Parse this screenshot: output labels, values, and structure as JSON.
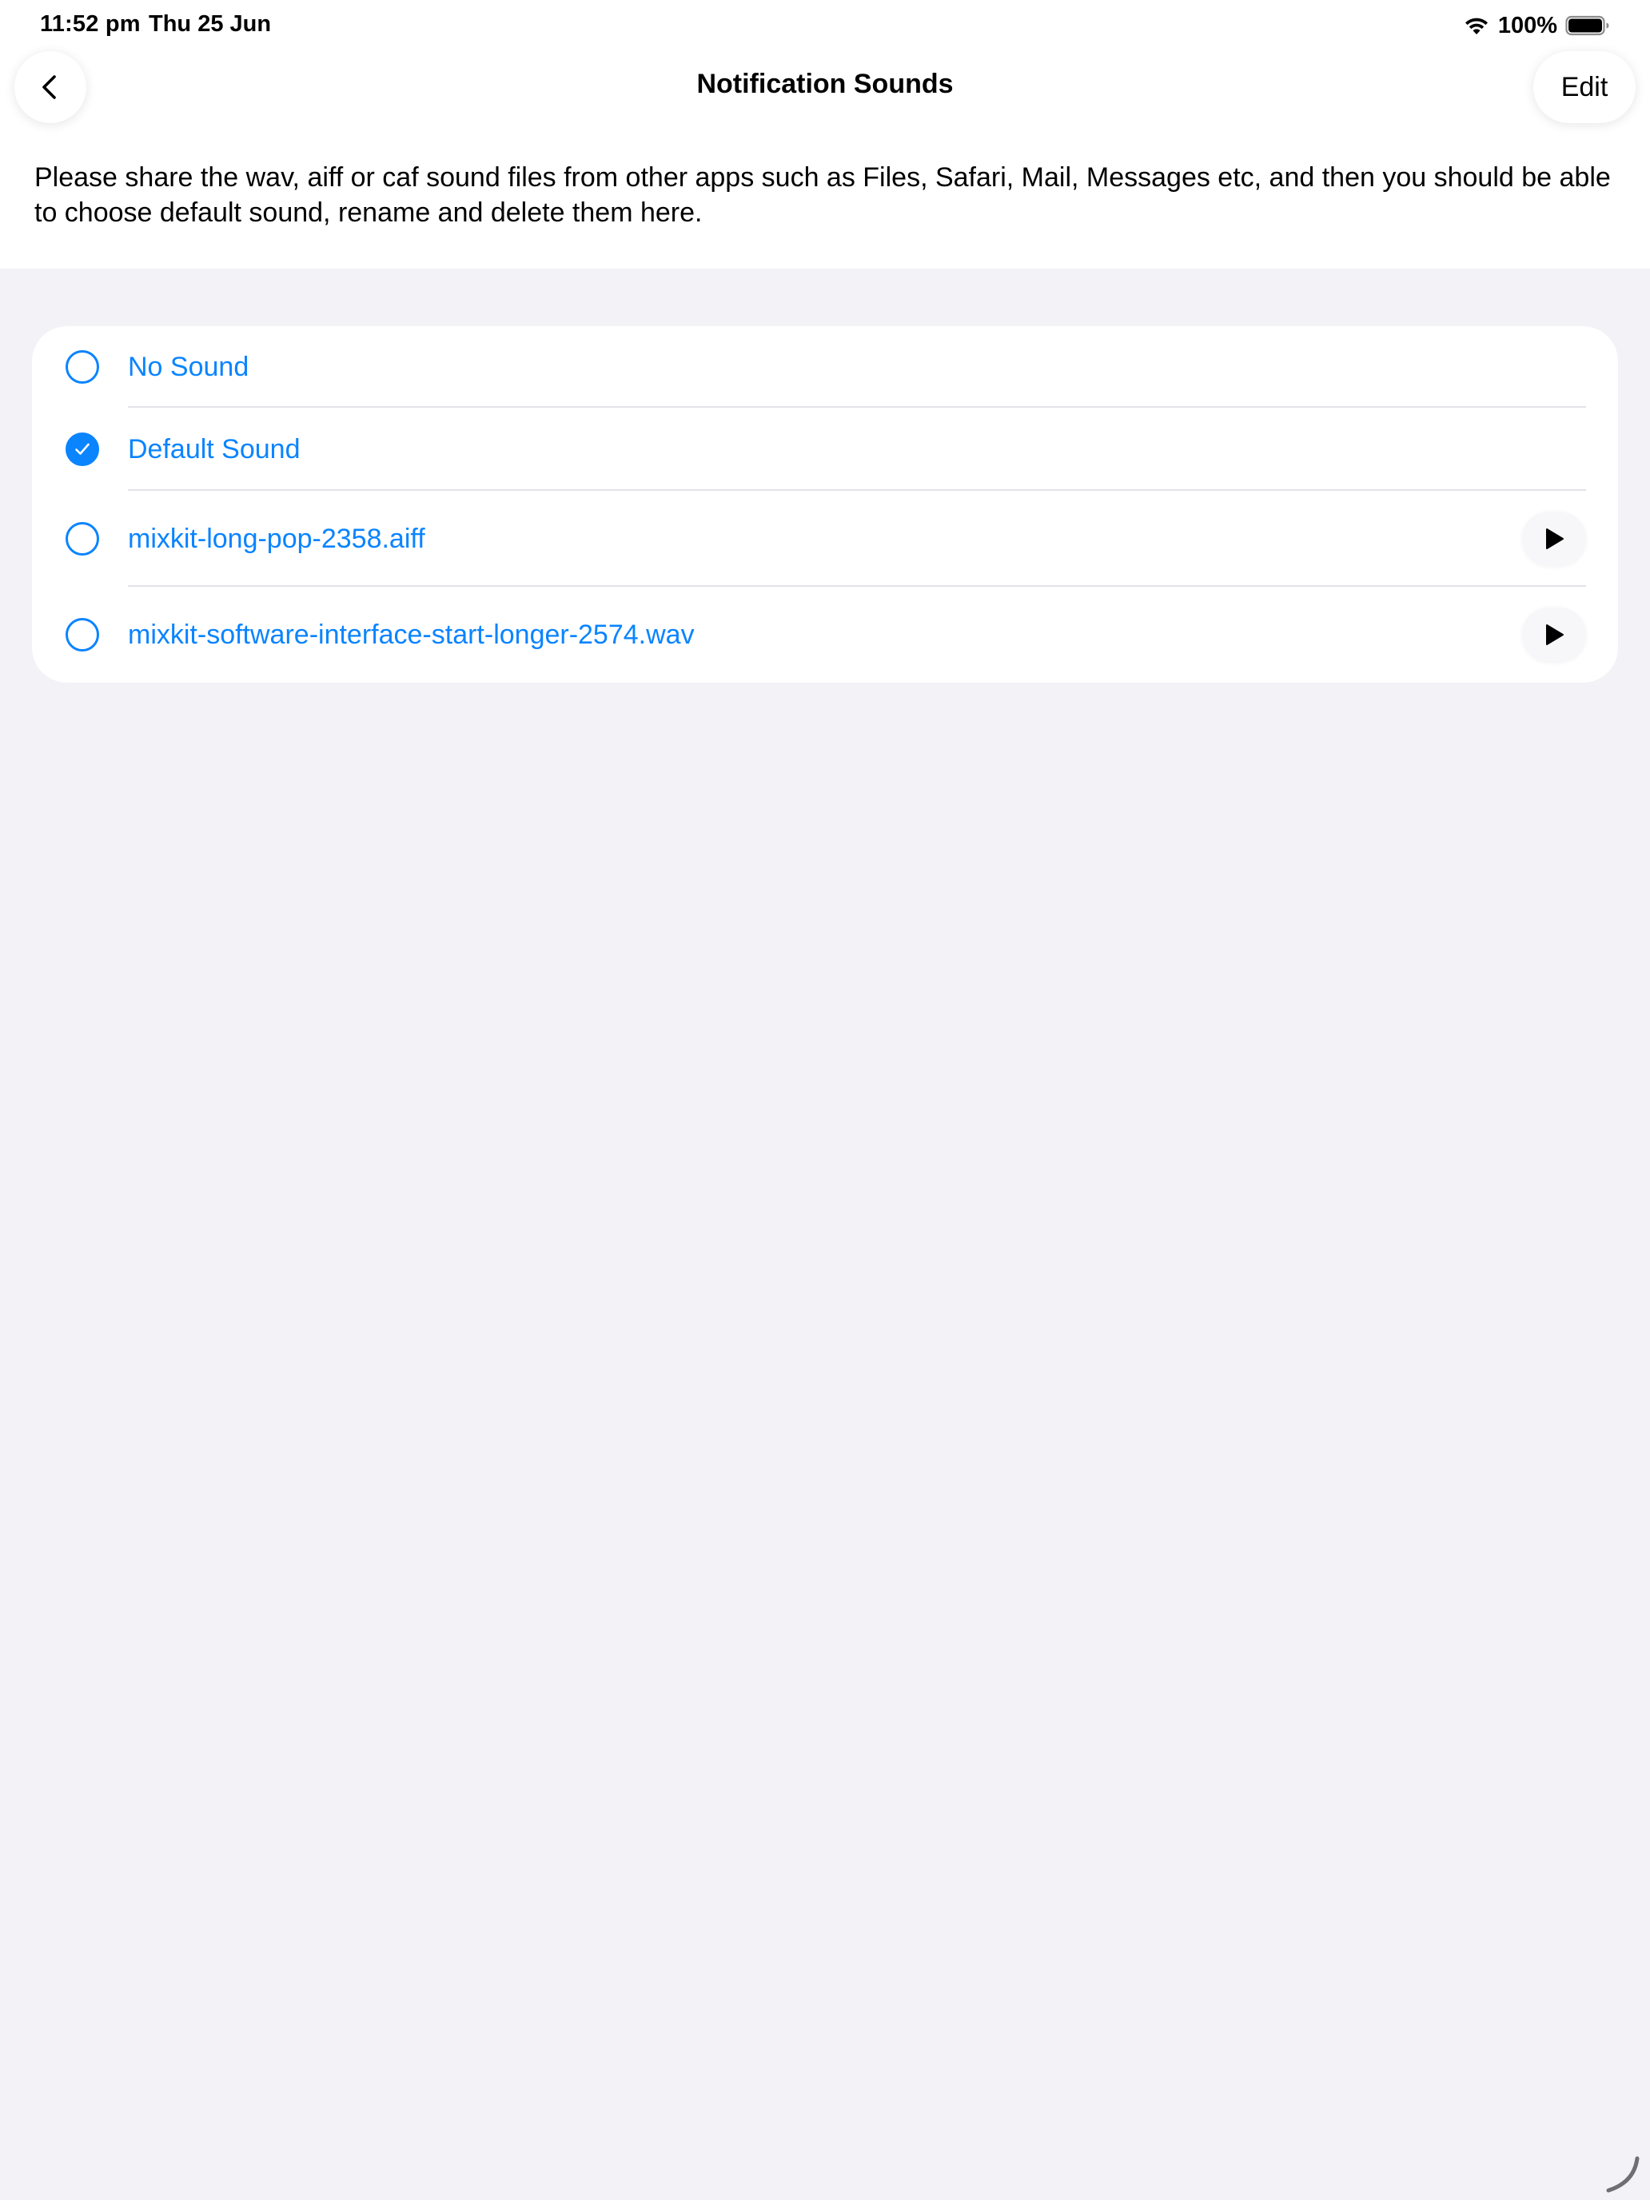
{
  "status_bar": {
    "time": "11:52 pm",
    "date": "Thu 25 Jun",
    "battery_percent": "100%",
    "icons": [
      "wifi-icon",
      "battery-icon"
    ]
  },
  "nav": {
    "title": "Notification Sounds",
    "back_icon": "chevron-left-icon",
    "edit_label": "Edit"
  },
  "description": "Please share the wav, aiff or caf sound files from other apps such as Files, Safari, Mail, Messages etc, and then you should be able to choose default sound, rename and delete them here.",
  "sounds": [
    {
      "label": "No Sound",
      "selected": false,
      "playable": false
    },
    {
      "label": "Default Sound",
      "selected": true,
      "playable": false
    },
    {
      "label": "mixkit-long-pop-2358.aiff",
      "selected": false,
      "playable": true
    },
    {
      "label": "mixkit-software-interface-start-longer-2574.wav",
      "selected": false,
      "playable": true
    }
  ],
  "colors": {
    "accent": "#0a84ff",
    "background": "#f2f2f7",
    "surface": "#ffffff"
  }
}
